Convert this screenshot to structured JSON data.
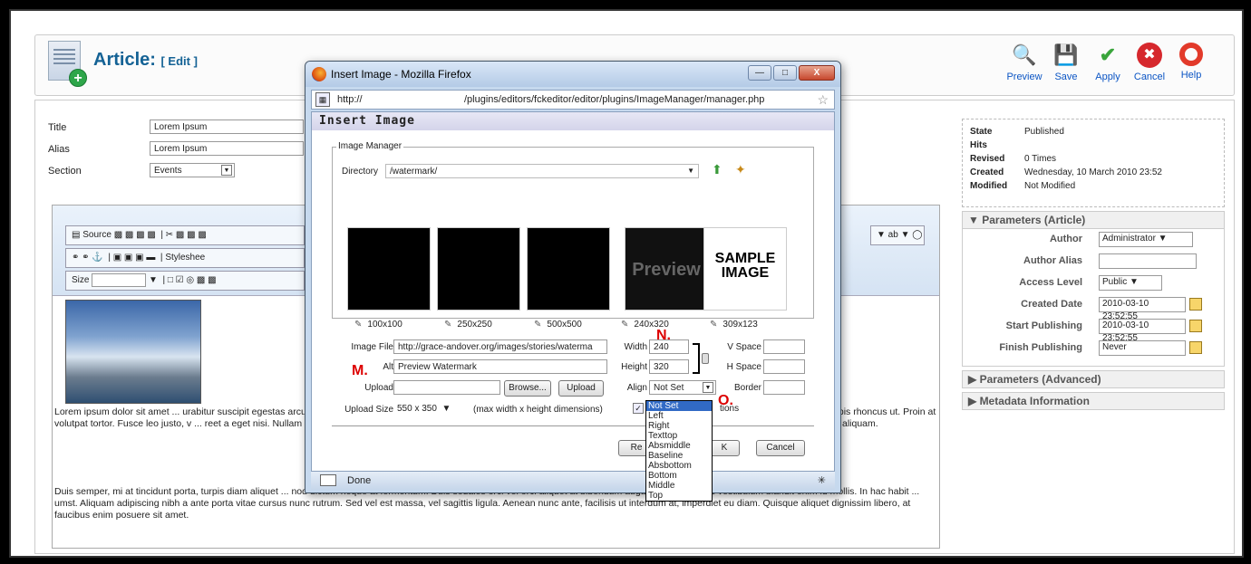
{
  "header": {
    "title": "Article:",
    "subtitle": "[ Edit ]"
  },
  "toolbar": [
    {
      "label": "Preview",
      "icon": "magnifier-icon"
    },
    {
      "label": "Save",
      "icon": "floppy-icon"
    },
    {
      "label": "Apply",
      "icon": "check-icon"
    },
    {
      "label": "Cancel",
      "icon": "cancel-icon"
    },
    {
      "label": "Help",
      "icon": "lifebuoy-icon"
    }
  ],
  "form": {
    "title_label": "Title",
    "title_value": "Lorem Ipsum",
    "alias_label": "Alias",
    "alias_value": "Lorem Ipsum",
    "section_label": "Section",
    "section_value": "Events"
  },
  "editor": {
    "source_label": "Source",
    "stylesheet_label": "Styleshee",
    "size_label": "Size",
    "para1": "Lorem ipsum dolor sit amet ... urabitur suscipit egestas arcu nec cursus. Cum sociis natoque penatibus ... lor a metus tristique id sagittis quam viverra. Ut rutrum, enim et in ... e blandit turpis rhoncus ut. Proin at volutpat tortor. Fusce leo justo, v ... reet a eget nisi. Nullam euismod massa sed neque venenatis accumsan. ... ctum vitae tortor. Suspendisse potenti. Proin imperdiet mauris at massa i ... aliquam.",
    "para2": "Duis semper, mi at tincidunt porta, turpis diam aliquet ... nod dictum neque at fermentum. Duis sodales orci vel orci aliquet at bibendum augue euismod. Cras vestibulum blandit enim id mollis. In hac habit ... umst. Aliquam adipiscing nibh a ante porta vitae cursus nunc rutrum. Sed vel est massa, vel sagittis ligula. Aenean nunc ante, facilisis ut interdum at, imperdiet eu diam. Quisque aliquet dignissim libero, at faucibus enim posuere sit amet."
  },
  "info": {
    "state_label": "State",
    "state_value": "Published",
    "hits_label": "Hits",
    "hits_value": "",
    "revised_label": "Revised",
    "revised_value": "0 Times",
    "created_label": "Created",
    "created_value": "Wednesday, 10 March 2010 23:52",
    "modified_label": "Modified",
    "modified_value": "Not Modified"
  },
  "params": {
    "header": "Parameters (Article)",
    "author_label": "Author",
    "author_value": "Administrator",
    "alias_label": "Author Alias",
    "alias_value": "",
    "access_label": "Access Level",
    "access_value": "Public",
    "created_label": "Created Date",
    "created_value": "2010-03-10 23:52:55",
    "start_label": "Start Publishing",
    "start_value": "2010-03-10 23:52:55",
    "finish_label": "Finish Publishing",
    "finish_value": "Never",
    "advanced": "Parameters (Advanced)",
    "metadata": "Metadata Information"
  },
  "popup": {
    "window_title": "Insert Image - Mozilla Firefox",
    "url_scheme": "http://",
    "url_path": "/plugins/editors/fckeditor/editor/plugins/ImageManager/manager.php",
    "heading": "Insert Image",
    "manager_legend": "Image Manager",
    "directory_label": "Directory",
    "directory_value": "/watermark/",
    "thumbs": [
      "100x100",
      "250x250",
      "500x500",
      "240x320",
      "309x123"
    ],
    "image_file_label": "Image File",
    "image_file_value": "http://grace-andover.org/images/stories/waterma",
    "alt_label": "Alt",
    "alt_value": "Preview Watermark",
    "upload_label": "Upload",
    "browse_label": "Browse...",
    "upload_btn": "Upload",
    "upload_size_label": "Upload Size",
    "upload_size_value": "550 x 350",
    "upload_size_hint": "(max width x height dimensions)",
    "width_label": "Width",
    "width_value": "240",
    "height_label": "Height",
    "height_value": "320",
    "align_label": "Align",
    "align_value": "Not Set",
    "vspace_label": "V Space",
    "hspace_label": "H Space",
    "border_label": "Border",
    "tions_fragment": "tions",
    "refresh_fragment": "Re",
    "ok_fragment": "K",
    "cancel_label": "Cancel",
    "status_text": "Done",
    "align_options": [
      "Not Set",
      "Left",
      "Right",
      "Texttop",
      "Absmiddle",
      "Baseline",
      "Absbottom",
      "Bottom",
      "Middle",
      "Top"
    ]
  },
  "markers": {
    "n": "N.",
    "m": "M.",
    "o": "O."
  },
  "sample_image_text": "SAMPLE IMAGE",
  "preview_text": "Preview"
}
